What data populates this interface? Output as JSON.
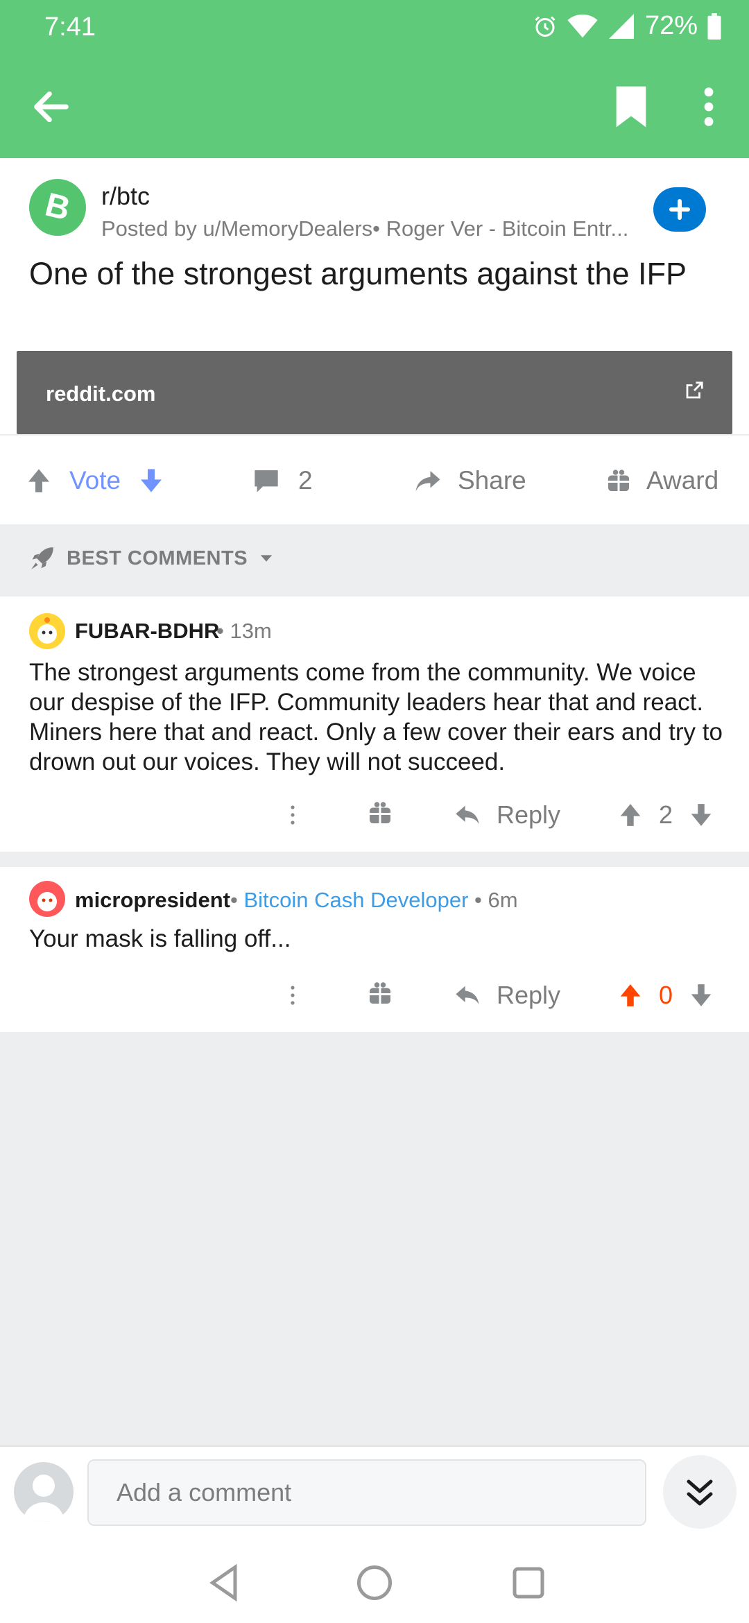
{
  "status": {
    "time": "7:41",
    "battery": "72%"
  },
  "app_bar": {
    "icons": [
      "back-arrow-icon",
      "bookmark-icon",
      "more-vert-icon"
    ]
  },
  "post": {
    "subreddit": "r/btc",
    "posted_by": "Posted by u/MemoryDealers• Roger Ver - Bitcoin Entr...",
    "title": "One of the strongest arguments against the IFP",
    "link_domain": "reddit.com",
    "vote_label": "Vote",
    "comment_count": "2",
    "share_label": "Share",
    "award_label": "Award"
  },
  "sort": {
    "label": "BEST COMMENTS"
  },
  "comments": [
    {
      "author": "FUBAR-BDHR",
      "age": "13m",
      "body": "The strongest arguments come from the community.  We voice our despise of the IFP.  Community leaders hear that and react.  Miners here that and react.  Only a few cover their ears and try to drown out our voices.  They will not succeed.",
      "reply_label": "Reply",
      "score": "2"
    },
    {
      "author": "micropresident",
      "flair": "Bitcoin Cash Developer",
      "age": "6m",
      "body": "Your mask is falling off...",
      "reply_label": "Reply",
      "score": "0"
    }
  ],
  "composer": {
    "placeholder": "Add a comment"
  },
  "colors": {
    "header_green": "#5fcb7a",
    "accent_blue": "#7193ff",
    "upvote_orange": "#ff4500",
    "flair_blue": "#3c9ce6"
  }
}
